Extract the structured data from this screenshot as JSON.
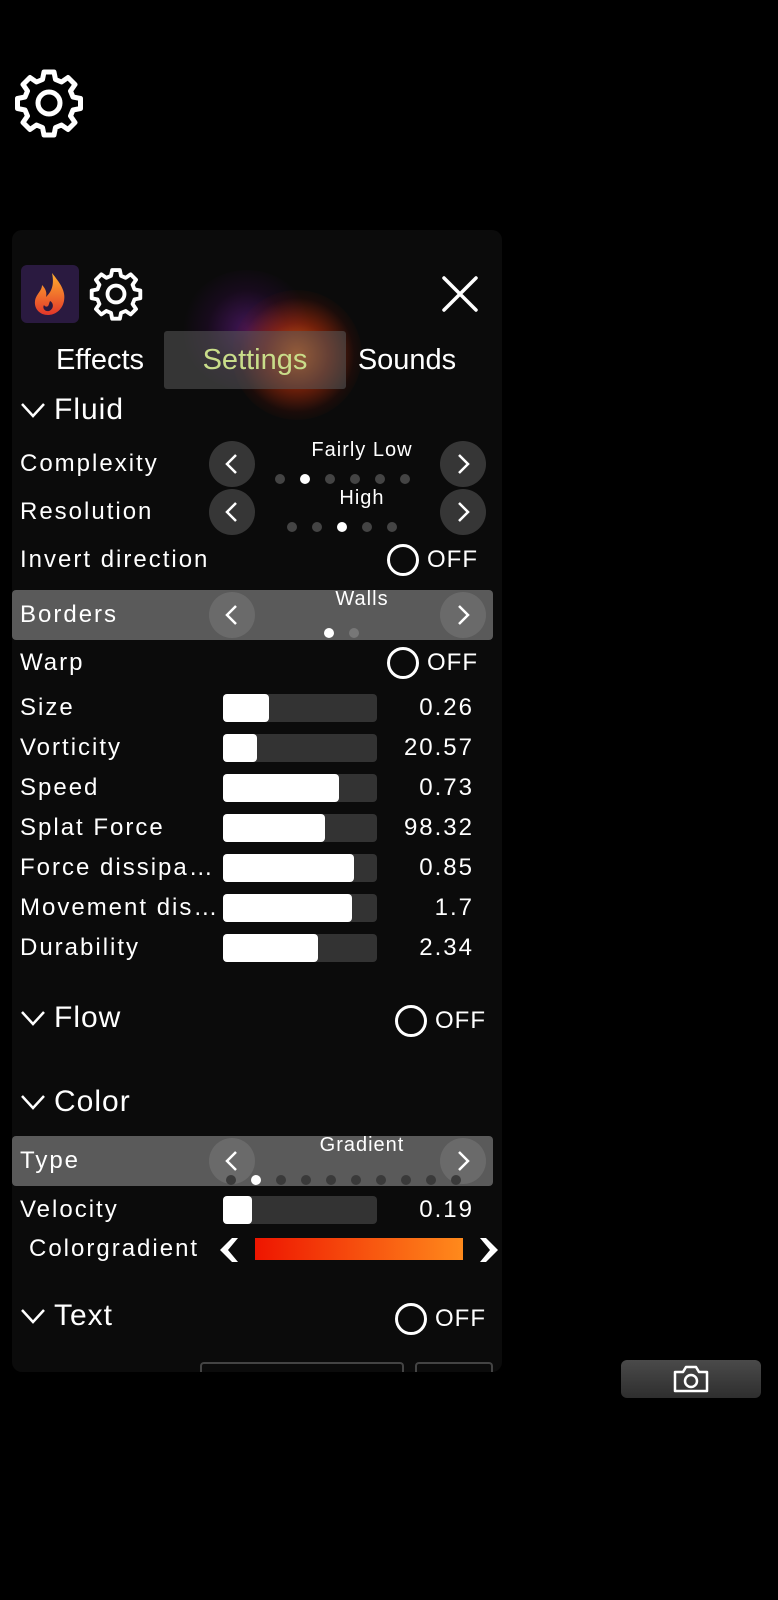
{
  "tabs": [
    {
      "label": "Effects",
      "active": false
    },
    {
      "label": "Settings",
      "active": true
    },
    {
      "label": "Sounds",
      "active": false
    }
  ],
  "fluid": {
    "title": "Fluid",
    "complexity": {
      "label": "Complexity",
      "value": "Fairly Low",
      "options_count": 6,
      "selected_index": 1
    },
    "resolution": {
      "label": "Resolution",
      "value": "High",
      "options_count": 5,
      "selected_index": 2
    },
    "invert_direction": {
      "label": "Invert direction",
      "state": "OFF"
    },
    "borders": {
      "label": "Borders",
      "value": "Walls",
      "options_count": 2,
      "selected_index": 0
    },
    "warp": {
      "label": "Warp",
      "state": "OFF"
    },
    "sliders": [
      {
        "label": "Size",
        "value": "0.26",
        "fill": 0.3
      },
      {
        "label": "Vorticity",
        "value": "20.57",
        "fill": 0.22
      },
      {
        "label": "Speed",
        "value": "0.73",
        "fill": 0.75
      },
      {
        "label": "Splat Force",
        "value": "98.32",
        "fill": 0.66
      },
      {
        "label": "Force dissipation",
        "value": "0.85",
        "fill": 0.85
      },
      {
        "label": "Movement dissipation",
        "value": "1.7",
        "fill": 0.84
      },
      {
        "label": "Durability",
        "value": "2.34",
        "fill": 0.62
      }
    ]
  },
  "flow": {
    "title": "Flow",
    "state": "OFF"
  },
  "color": {
    "title": "Color",
    "type": {
      "label": "Type",
      "value": "Gradient",
      "options_count": 10,
      "selected_index": 1
    },
    "velocity": {
      "label": "Velocity",
      "value": "0.19",
      "fill": 0.19
    },
    "colorgradient": {
      "label": "Colorgradient",
      "start_color": "#ee1500",
      "end_color": "#ff8a1c"
    }
  },
  "text": {
    "title": "Text",
    "state": "OFF"
  },
  "accent_color": "#c9dd8a",
  "icons": [
    "gear-icon",
    "app-flame-icon",
    "close-icon",
    "chevron-down-icon",
    "chevron-left-icon",
    "chevron-right-icon",
    "camera-icon"
  ]
}
